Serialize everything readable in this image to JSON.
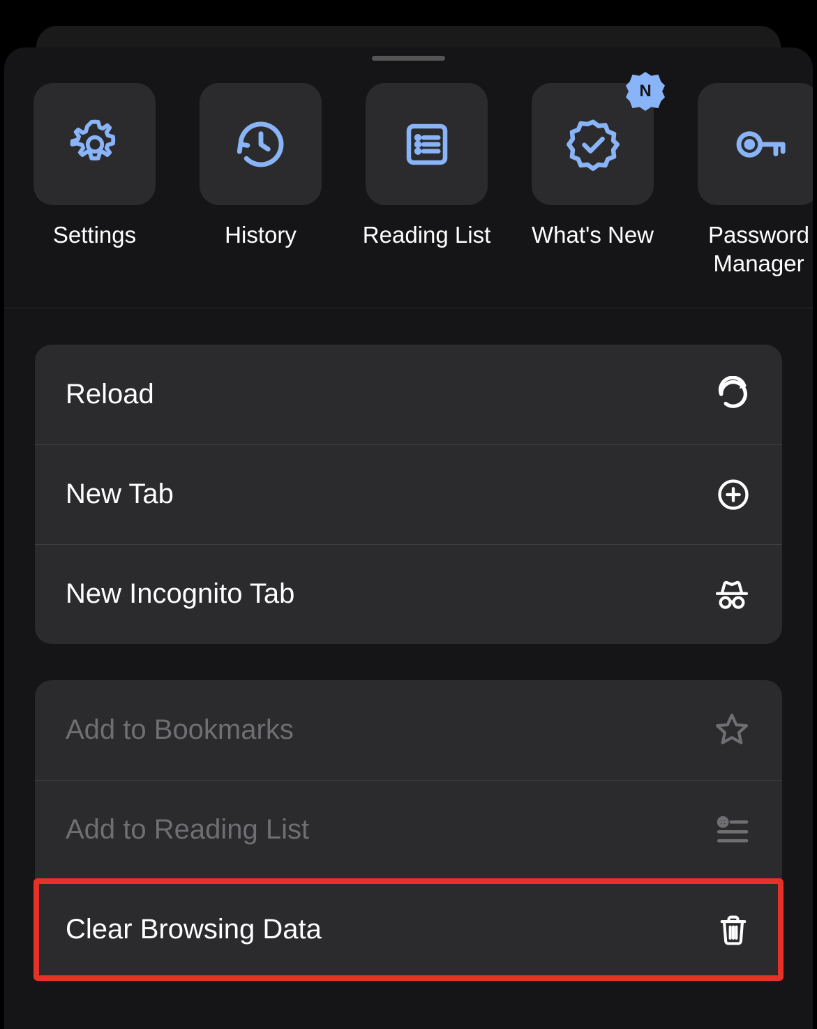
{
  "shortcuts": [
    {
      "label": "Settings",
      "icon": "gear-icon",
      "badge": null
    },
    {
      "label": "History",
      "icon": "history-icon",
      "badge": null
    },
    {
      "label": "Reading List",
      "icon": "reading-list-icon",
      "badge": null
    },
    {
      "label": "What's New",
      "icon": "whats-new-icon",
      "badge": "N"
    },
    {
      "label": "Password\nManager",
      "icon": "key-icon",
      "badge": null
    }
  ],
  "groups": [
    {
      "items": [
        {
          "label": "Reload",
          "icon": "reload-icon",
          "disabled": false
        },
        {
          "label": "New Tab",
          "icon": "plus-circle-icon",
          "disabled": false
        },
        {
          "label": "New Incognito Tab",
          "icon": "incognito-icon",
          "disabled": false
        }
      ]
    },
    {
      "items": [
        {
          "label": "Add to Bookmarks",
          "icon": "star-icon",
          "disabled": true
        },
        {
          "label": "Add to Reading List",
          "icon": "add-reading-list-icon",
          "disabled": true
        },
        {
          "label": "Clear Browsing Data",
          "icon": "trash-icon",
          "disabled": false,
          "highlight": true
        }
      ]
    }
  ],
  "accent": "#8ab4f8"
}
